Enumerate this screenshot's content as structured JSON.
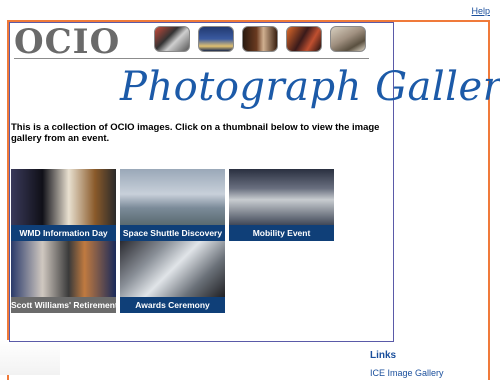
{
  "header": {
    "help_link": "Help",
    "logo": "OCIO",
    "header_thumbnails": [
      "thumbnail-1",
      "thumbnail-2",
      "thumbnail-3",
      "thumbnail-4",
      "thumbnail-5"
    ]
  },
  "main": {
    "title": "Photograph Gallery",
    "intro": "This is a collection of OCIO images. Click on a thumbnail below to view the image gallery from an event.",
    "gallery": [
      {
        "caption": "WMD Information Day"
      },
      {
        "caption": "Space Shuttle Discovery"
      },
      {
        "caption": "Mobility Event"
      },
      {
        "caption": "Scott Williams' Retirement"
      },
      {
        "caption": "Awards Ceremony"
      }
    ]
  },
  "sidebar": {
    "links_heading": "Links",
    "links": [
      "ICE Image Gallery"
    ]
  },
  "colors": {
    "accent_orange": "#f07a3a",
    "brand_blue": "#1c5aa8",
    "caption_blue": "#0f3f78"
  }
}
